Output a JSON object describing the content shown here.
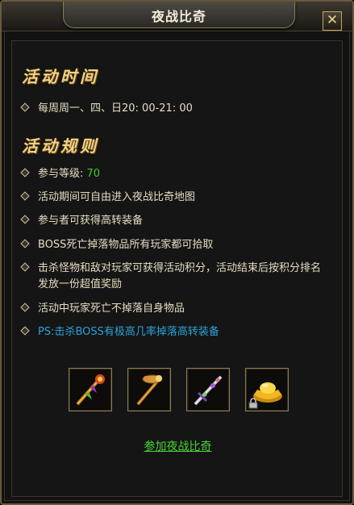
{
  "window": {
    "title": "夜战比奇",
    "close_icon": "✕"
  },
  "sections": {
    "time_heading": "活动时间",
    "time_text": "每周周一、四、日20: 00-21: 00",
    "rules_heading": "活动规则",
    "level_label": "参与等级: ",
    "level_value": "70",
    "rules": [
      "活动期间可自由进入夜战比奇地图",
      "参与者可获得高转装备",
      "BOSS死亡掉落物品所有玩家都可拾取",
      "击杀怪物和敌对玩家可获得活动积分，活动结束后按积分排名发放一份超值奖励",
      "活动中玩家死亡不掉落自身物品"
    ],
    "ps_note": "PS:击杀BOSS有极高几率掉落高转装备"
  },
  "rewards": [
    {
      "icon": "flame-staff-icon"
    },
    {
      "icon": "golden-scepter-icon"
    },
    {
      "icon": "crystal-sword-icon"
    },
    {
      "icon": "gold-ingot-icon",
      "locked": true
    }
  ],
  "join_label": "参加夜战比奇",
  "colors": {
    "heading": "#f1d28a",
    "level": "#3ecf2b",
    "ps": "#2aa4d8",
    "link": "#49d634"
  }
}
